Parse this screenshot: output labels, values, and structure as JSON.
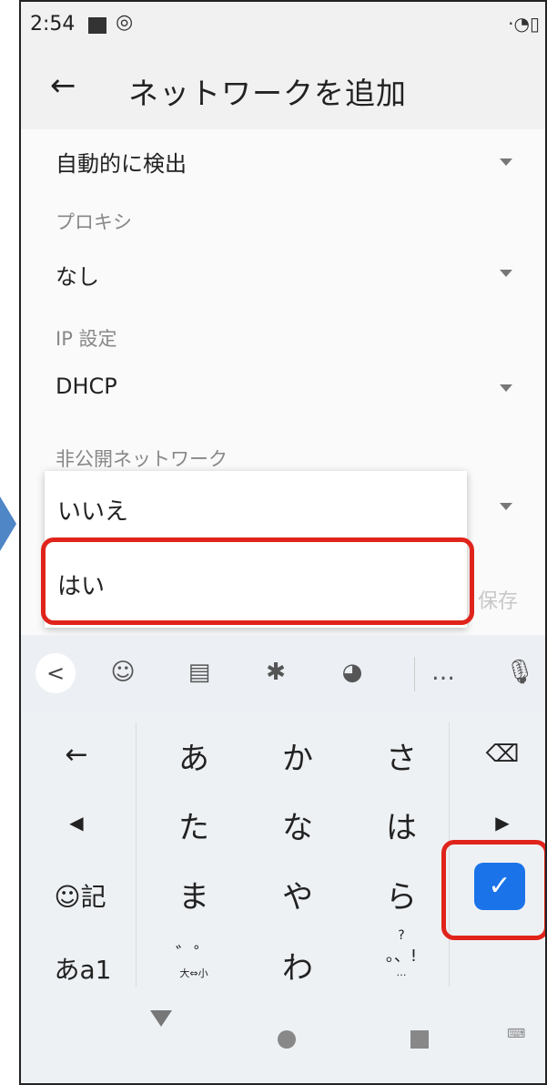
{
  "status_bar": {
    "time": "2:54",
    "right_icons": "▾◔▯"
  },
  "app_bar": {
    "title": "ネットワークを追加"
  },
  "form": {
    "proxy_auto_value": "自動的に検出",
    "proxy_label": "プロキシ",
    "proxy_value": "なし",
    "ip_label": "IP 設定",
    "ip_value": "DHCP",
    "hidden_label": "非公開ネットワーク",
    "save_label": "保存"
  },
  "dropdown": {
    "options": [
      "いいえ",
      "はい"
    ],
    "highlighted_option": "はい"
  },
  "keyboard_toolbar": {
    "back": "<",
    "emoji_icon": "sticker-icon",
    "clipboard_icon": "clipboard-icon",
    "settings_icon": "gear-icon",
    "theme_icon": "palette-icon",
    "more": "…",
    "mic_icon": "mic-icon"
  },
  "keyboard": {
    "row1": [
      "←",
      "あ",
      "か",
      "さ",
      "⌫"
    ],
    "row2": [
      "◀",
      "た",
      "な",
      "は",
      "▶"
    ],
    "row3": [
      "☺記",
      "ま",
      "や",
      "ら",
      "⎵"
    ],
    "row4_left": "あa1",
    "row4_daku": "゛゜",
    "row4_daku_sub": "大⇔小",
    "row4_wa": "わ",
    "row4_punct_top": "?",
    "row4_punct": "。、!",
    "row4_punct_sub": "…",
    "enter": "✓"
  },
  "colors": {
    "highlight": "#e0241b",
    "enter_key": "#1a73e8",
    "pointer_arrow": "#4f86c6"
  }
}
